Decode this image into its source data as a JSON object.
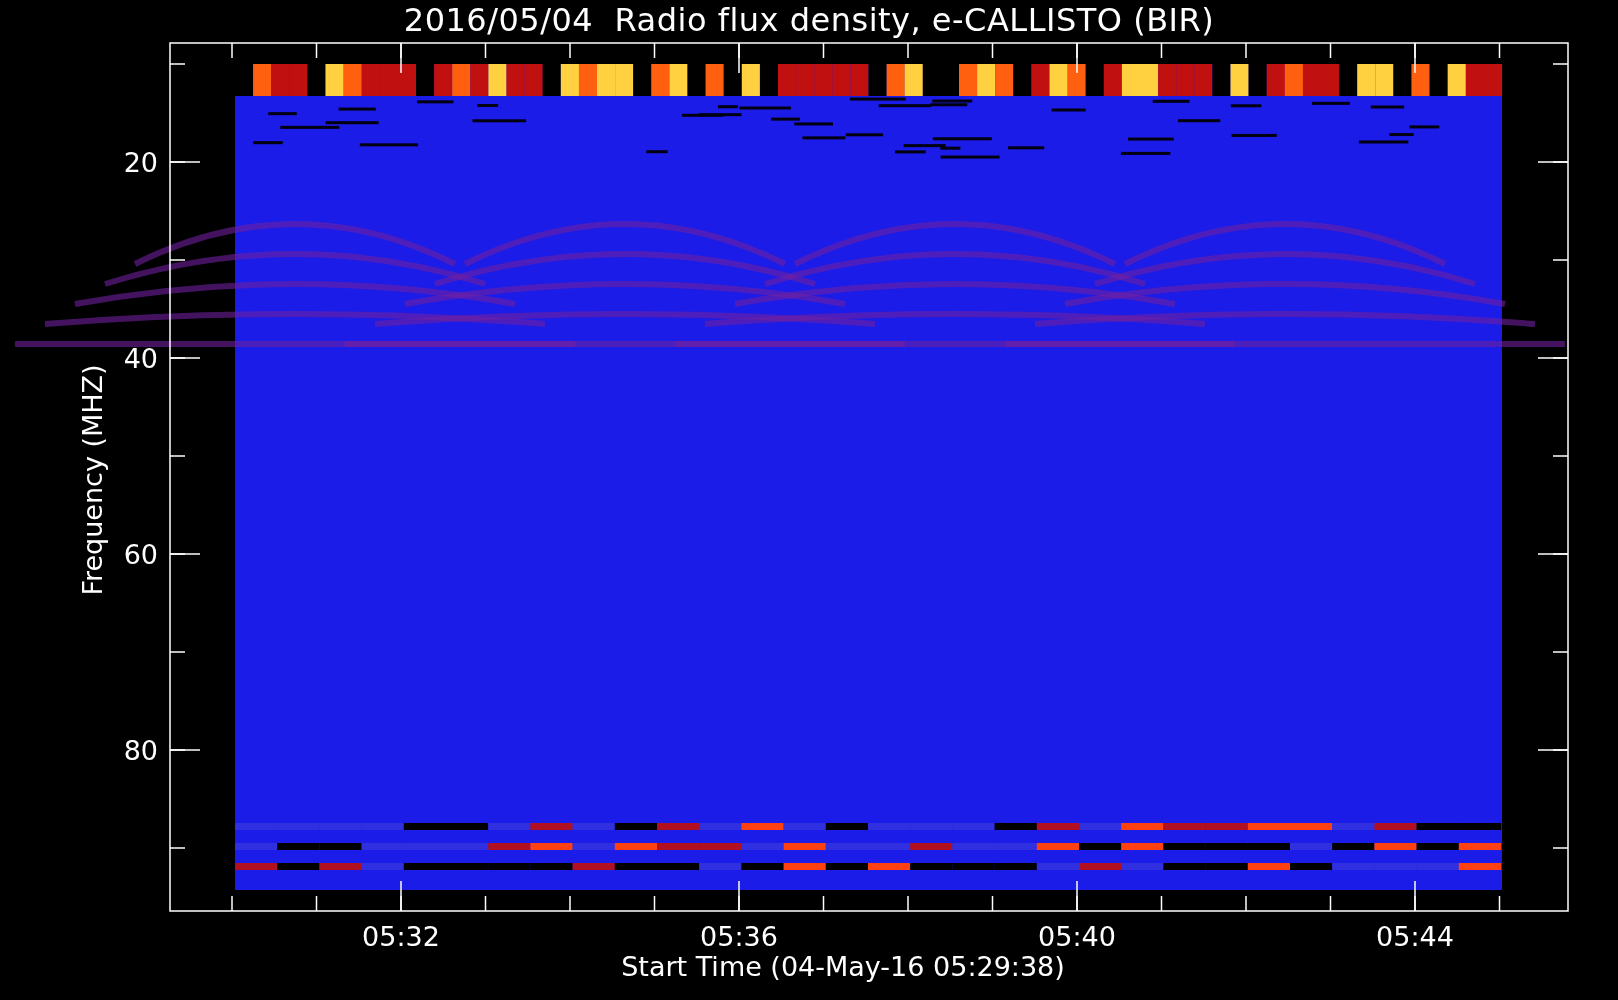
{
  "title": "2016/05/04  Radio flux density, e-CALLISTO (BIR)",
  "plot": {
    "ylabel": "Frequency (MHZ)",
    "xlabel": "Start Time (04-May-16 05:29:38)",
    "yticks": [
      "20",
      "40",
      "60",
      "80"
    ],
    "xticks": [
      "05:32",
      "05:36",
      "05:40",
      "05:44"
    ]
  }
}
